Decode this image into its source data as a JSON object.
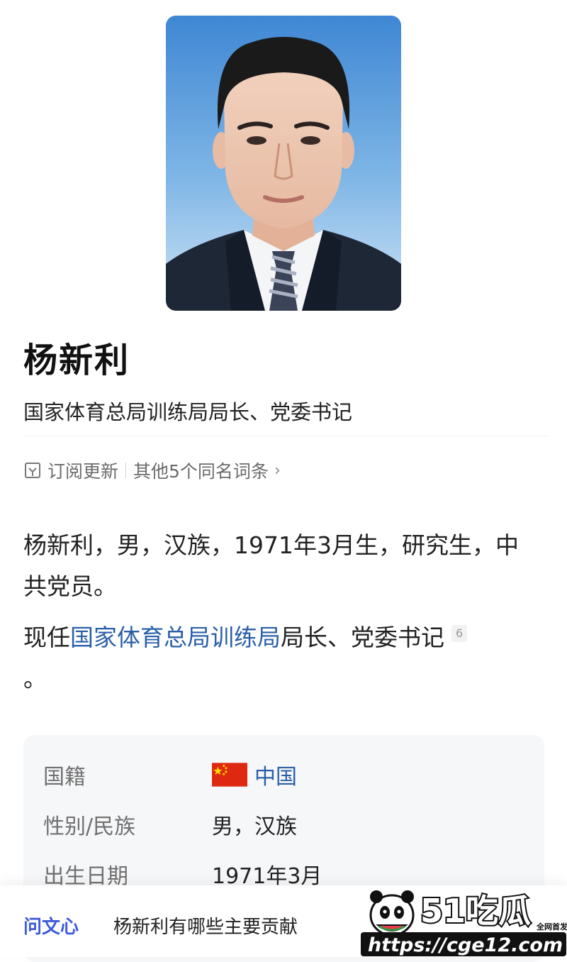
{
  "person": {
    "name": "杨新利",
    "title": "国家体育总局训练局局长、党委书记"
  },
  "actions": {
    "subscribe": "订阅更新",
    "other_entries": "其他5个同名词条",
    "chevron": "›",
    "icons": [
      "subscribe-icon",
      "chevron-right-icon"
    ]
  },
  "summary": {
    "line1": "杨新利，男，汉族，1971年3月生，研究生，中共党员。",
    "para2_prefix": "现任",
    "para2_link": "国家体育总局训练局",
    "para2_suffix": "局长、党委书记",
    "citation": "6",
    "para2_end": "。"
  },
  "info": [
    {
      "label": "国籍",
      "value": "中国",
      "flag": "china"
    },
    {
      "label": "性别/民族",
      "value": "男，汉族"
    },
    {
      "label": "出生日期",
      "value": "1971年3月"
    }
  ],
  "bottom_bar": {
    "brand": "问文心",
    "question": "杨新利有哪些主要贡献"
  },
  "watermark": {
    "big_text": "51吃瓜",
    "small_text": "全网首发",
    "url": "https://cge12.com"
  },
  "colors": {
    "link": "#2a5fa8",
    "brand_blue": "#3d5bd9",
    "photo_bg_top": "#4a8fd6",
    "card_bg": "#f6f7f9"
  }
}
